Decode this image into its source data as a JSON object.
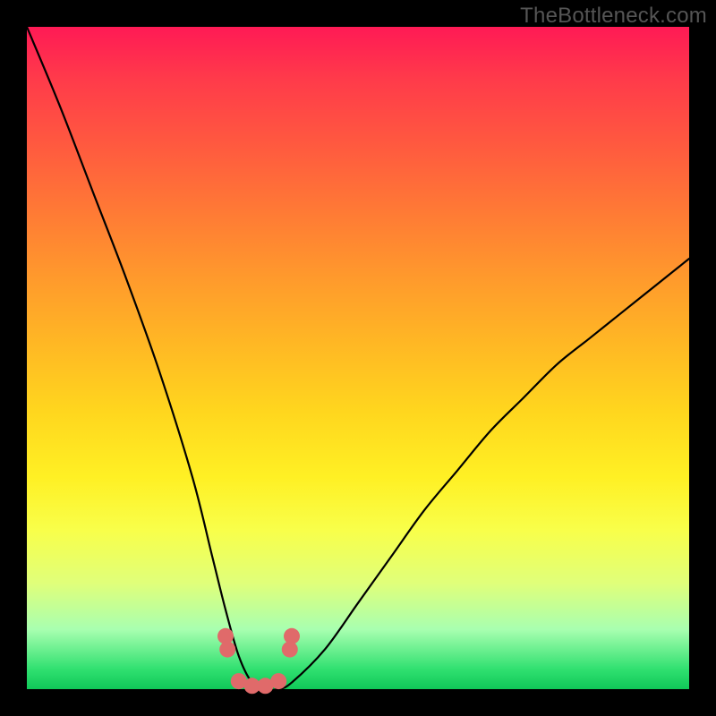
{
  "watermark": "TheBottleneck.com",
  "colors": {
    "frame": "#000000",
    "curve": "#000000",
    "markers": "#e06a6a",
    "gradient_top": "#ff1a55",
    "gradient_bottom": "#10c858"
  },
  "chart_data": {
    "type": "line",
    "title": "",
    "xlabel": "",
    "ylabel": "",
    "xlim": [
      0,
      100
    ],
    "ylim": [
      0,
      100
    ],
    "grid": false,
    "legend": false,
    "note": "Bottleneck-style V-curve. y ≈ 0 near x ≈ 33–40 (optimal, green band); y rises steeply toward 100 as x → 0 and more gradually toward ~65 as x → 100.",
    "series": [
      {
        "name": "bottleneck-curve",
        "x": [
          0,
          5,
          10,
          15,
          20,
          25,
          28,
          30,
          32,
          34,
          36,
          38,
          40,
          45,
          50,
          55,
          60,
          65,
          70,
          75,
          80,
          85,
          90,
          95,
          100
        ],
        "y": [
          100,
          88,
          75,
          62,
          48,
          32,
          20,
          12,
          5,
          1,
          0,
          0,
          1,
          6,
          13,
          20,
          27,
          33,
          39,
          44,
          49,
          53,
          57,
          61,
          65
        ]
      }
    ],
    "markers": {
      "name": "near-minimum-dots",
      "x": [
        30.0,
        30.3,
        32.0,
        34.0,
        36.0,
        38.0,
        39.7,
        40.0
      ],
      "y": [
        8.0,
        6.0,
        1.2,
        0.5,
        0.5,
        1.2,
        6.0,
        8.0
      ]
    }
  }
}
